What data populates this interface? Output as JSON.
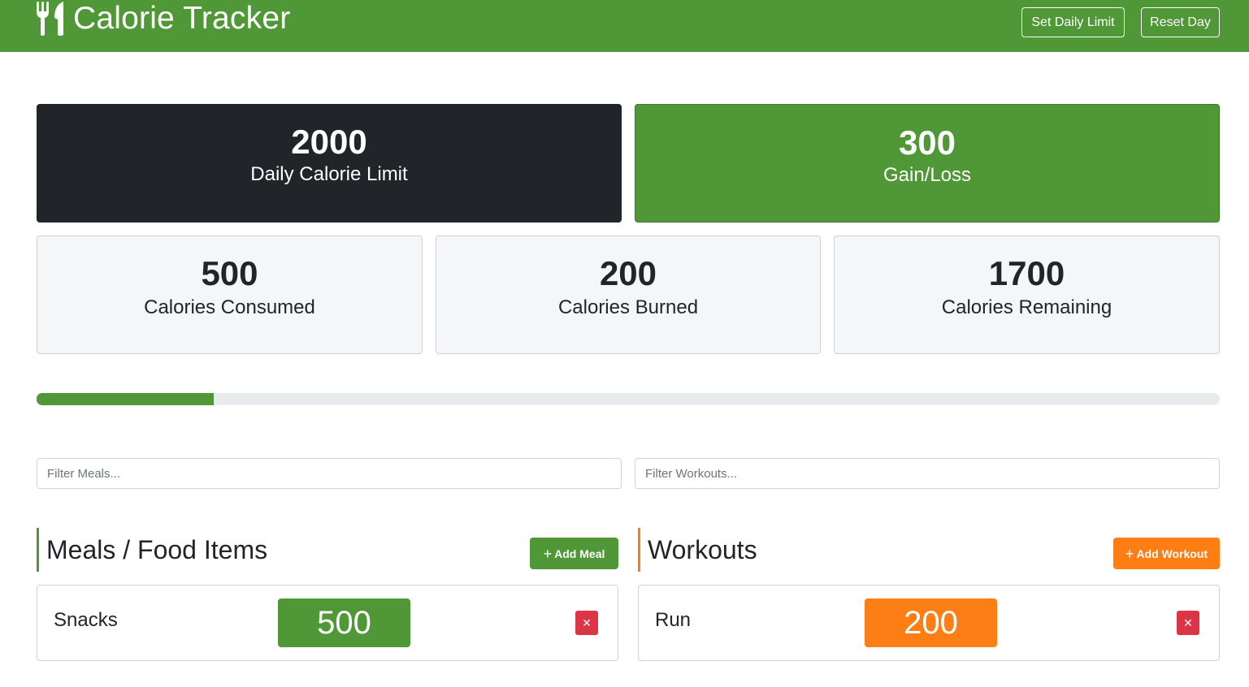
{
  "app": {
    "title": "Calorie Tracker",
    "brand_icon": "utensils-icon"
  },
  "header": {
    "set_limit_label": "Set Daily Limit",
    "reset_label": "Reset Day"
  },
  "stats": {
    "daily_limit": {
      "value": "2000",
      "label": "Daily Calorie Limit"
    },
    "gain_loss": {
      "value": "300",
      "label": "Gain/Loss"
    },
    "consumed": {
      "value": "500",
      "label": "Calories Consumed"
    },
    "burned": {
      "value": "200",
      "label": "Calories Burned"
    },
    "remaining": {
      "value": "1700",
      "label": "Calories Remaining"
    }
  },
  "progress": {
    "percent": 15
  },
  "filters": {
    "meals_placeholder": "Filter Meals...",
    "meals_value": "",
    "workouts_placeholder": "Filter Workouts...",
    "workouts_value": ""
  },
  "meals": {
    "title": "Meals / Food Items",
    "add_label": "Add Meal",
    "items": [
      {
        "name": "Snacks",
        "calories": "500",
        "delete_icon": "close-icon"
      }
    ]
  },
  "workouts": {
    "title": "Workouts",
    "add_label": "Add Workout",
    "items": [
      {
        "name": "Run",
        "calories": "200",
        "delete_icon": "close-icon"
      }
    ]
  },
  "colors": {
    "primary": "#509737",
    "dark": "#212529",
    "workout": "#fd7e14",
    "danger": "#dc3545",
    "light": "#f5f6f8"
  }
}
